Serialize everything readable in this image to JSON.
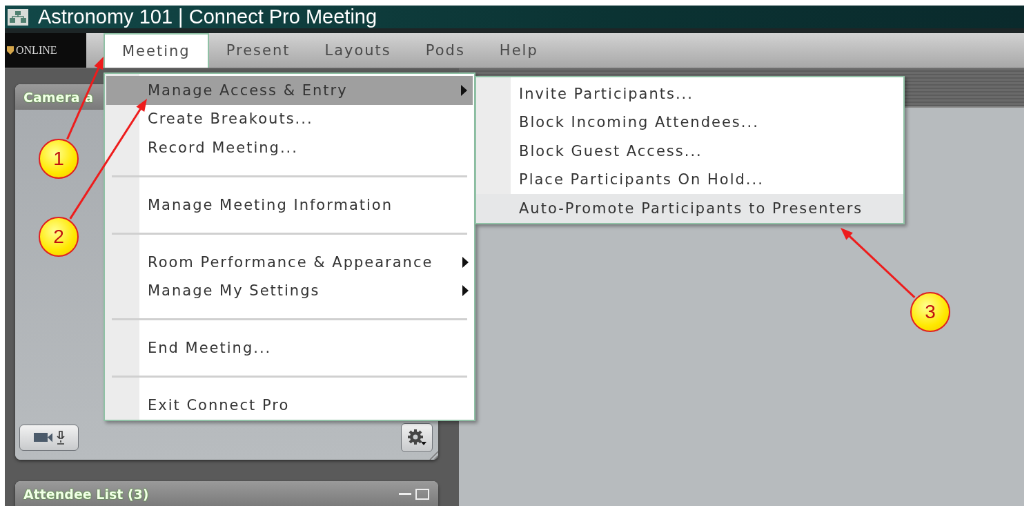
{
  "window": {
    "title": "Astronomy 101 | Connect Pro Meeting"
  },
  "brand": {
    "logo_text": "ONLINE"
  },
  "menu_bar": [
    {
      "label": "Meeting",
      "selected": true
    },
    {
      "label": "Present",
      "selected": false
    },
    {
      "label": "Layouts",
      "selected": false
    },
    {
      "label": "Pods",
      "selected": false
    },
    {
      "label": "Help",
      "selected": false
    }
  ],
  "meeting_menu": {
    "items": [
      {
        "kind": "item",
        "label": "Manage Access & Entry",
        "submenu": true,
        "selected": true
      },
      {
        "kind": "item",
        "label": "Create Breakouts...",
        "submenu": false,
        "selected": false
      },
      {
        "kind": "item",
        "label": "Record Meeting...",
        "submenu": false,
        "selected": false
      },
      {
        "kind": "separator"
      },
      {
        "kind": "item",
        "label": "Manage Meeting Information",
        "submenu": false,
        "selected": false
      },
      {
        "kind": "separator"
      },
      {
        "kind": "item",
        "label": "Room Performance & Appearance",
        "submenu": true,
        "selected": false
      },
      {
        "kind": "item",
        "label": "Manage My Settings",
        "submenu": true,
        "selected": false
      },
      {
        "kind": "separator"
      },
      {
        "kind": "item",
        "label": "End Meeting...",
        "submenu": false,
        "selected": false
      },
      {
        "kind": "separator"
      },
      {
        "kind": "item",
        "label": "Exit Connect Pro",
        "submenu": false,
        "selected": false
      }
    ]
  },
  "submenu": {
    "items": [
      {
        "label": "Invite Participants...",
        "selected": false
      },
      {
        "label": "Block Incoming Attendees...",
        "selected": false
      },
      {
        "label": "Block Guest Access...",
        "selected": false
      },
      {
        "label": "Place Participants On Hold...",
        "selected": false
      },
      {
        "label": "Auto-Promote Participants to Presenters",
        "selected": true
      }
    ]
  },
  "pods": [
    {
      "kind": "camera",
      "title": "Camera a"
    },
    {
      "kind": "list",
      "title": "Attendee List (3)"
    }
  ],
  "callouts": [
    {
      "number": "1"
    },
    {
      "number": "2"
    },
    {
      "number": "3"
    }
  ]
}
